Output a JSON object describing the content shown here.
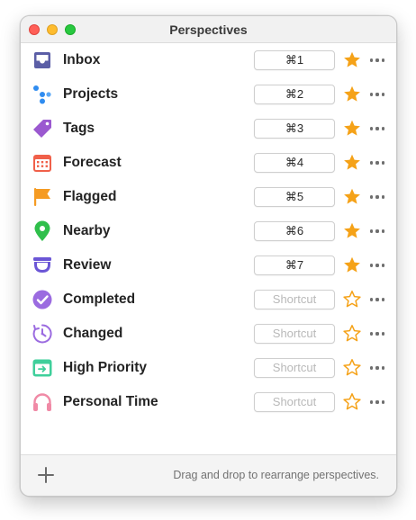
{
  "window": {
    "title": "Perspectives"
  },
  "colors": {
    "star": "#f5a218",
    "inbox": "#5b5ea6",
    "projects": "#2f8cf0",
    "tags": "#9b59d0",
    "forecast": "#f0604a",
    "flagged": "#f59b23",
    "nearby": "#2fbf4b",
    "review": "#6b56d6",
    "completed": "#9b6be0",
    "changed": "#9b6be0",
    "high_priority": "#3fcf9b",
    "personal_time": "#f08aa6"
  },
  "perspectives": [
    {
      "name": "Inbox",
      "shortcut": "⌘1",
      "has_shortcut": true,
      "favorite": true,
      "icon": "inbox-tray-icon"
    },
    {
      "name": "Projects",
      "shortcut": "⌘2",
      "has_shortcut": true,
      "favorite": true,
      "icon": "projects-dots-icon"
    },
    {
      "name": "Tags",
      "shortcut": "⌘3",
      "has_shortcut": true,
      "favorite": true,
      "icon": "tag-icon"
    },
    {
      "name": "Forecast",
      "shortcut": "⌘4",
      "has_shortcut": true,
      "favorite": true,
      "icon": "calendar-icon"
    },
    {
      "name": "Flagged",
      "shortcut": "⌘5",
      "has_shortcut": true,
      "favorite": true,
      "icon": "flag-icon"
    },
    {
      "name": "Nearby",
      "shortcut": "⌘6",
      "has_shortcut": true,
      "favorite": true,
      "icon": "location-pin-icon"
    },
    {
      "name": "Review",
      "shortcut": "⌘7",
      "has_shortcut": true,
      "favorite": true,
      "icon": "review-cup-icon"
    },
    {
      "name": "Completed",
      "shortcut": "Shortcut",
      "has_shortcut": false,
      "favorite": false,
      "icon": "checkmark-circle-icon"
    },
    {
      "name": "Changed",
      "shortcut": "Shortcut",
      "has_shortcut": false,
      "favorite": false,
      "icon": "changed-clock-icon"
    },
    {
      "name": "High Priority",
      "shortcut": "Shortcut",
      "has_shortcut": false,
      "favorite": false,
      "icon": "high-priority-icon"
    },
    {
      "name": "Personal Time",
      "shortcut": "Shortcut",
      "has_shortcut": false,
      "favorite": false,
      "icon": "headphones-icon"
    }
  ],
  "footer": {
    "add_icon": "plus-icon",
    "hint": "Drag and drop to rearrange perspectives."
  }
}
